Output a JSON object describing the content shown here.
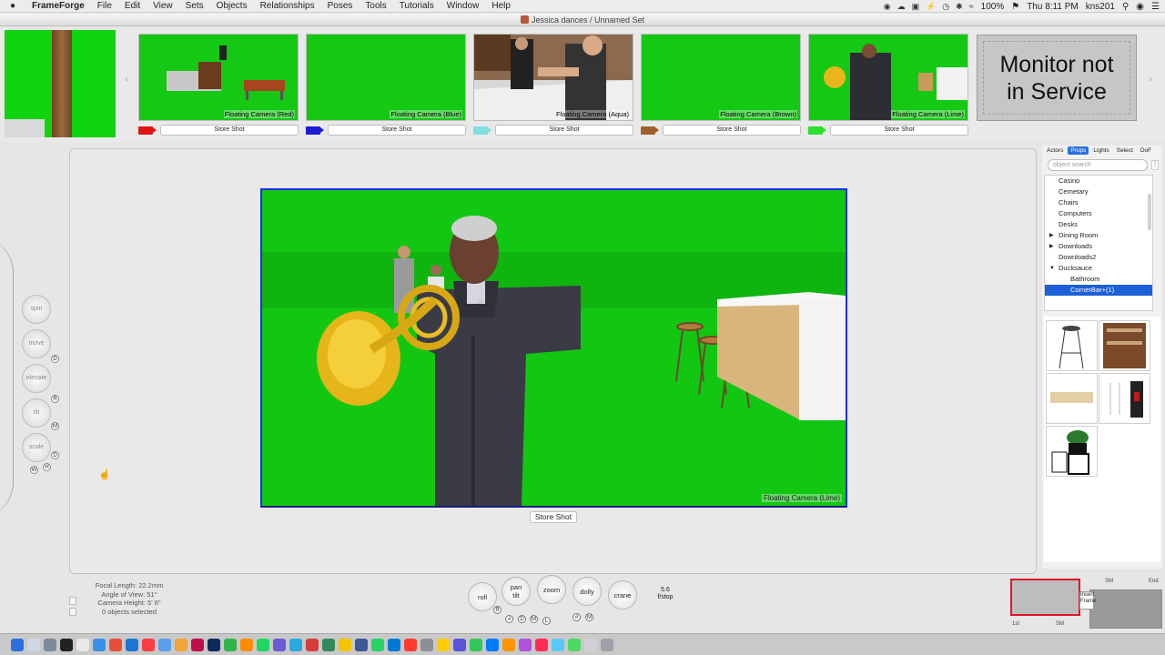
{
  "menubar": {
    "apple": "",
    "items": [
      "FrameForge",
      "File",
      "Edit",
      "View",
      "Sets",
      "Objects",
      "Relationships",
      "Poses",
      "Tools",
      "Tutorials",
      "Window",
      "Help"
    ],
    "battery": "100%",
    "clock": "Thu 8:11 PM",
    "user": "kns201"
  },
  "window": {
    "title": "Jessica dances / Unnamed Set"
  },
  "cameras": [
    {
      "caption": "Floating Camera (Red)",
      "color": "#e01616",
      "store": "Store Shot"
    },
    {
      "caption": "Floating Camera (Blue)",
      "color": "#1c1cd4",
      "store": "Store Shot"
    },
    {
      "caption": "Floating Camera (Aqua)",
      "color": "#7fdede",
      "store": "Store Shot"
    },
    {
      "caption": "Floating Camera (Brown)",
      "color": "#a0602c",
      "store": "Store Shot"
    },
    {
      "caption": "Floating Camera (Lime)",
      "color": "#2ee02e",
      "store": "Store Shot"
    }
  ],
  "monitor": {
    "line1": "Monitor not",
    "line2": "in Service"
  },
  "viewport": {
    "caption": "Floating Camera (Lime)",
    "store": "Store Shot"
  },
  "navwheel": {
    "spin": "spin",
    "move": "move",
    "elevate": "elevate",
    "tilt": "tilt",
    "scale": "scale",
    "d": "D",
    "r": "R",
    "m": "M",
    "w": "W",
    "h": "H"
  },
  "panel": {
    "tabs": [
      "Actors",
      "Props",
      "Lights",
      "Select",
      "DoF"
    ],
    "active_tab": "Props",
    "search_placeholder": "object search",
    "tree": [
      "Casino",
      "Cemetary",
      "Chairs",
      "Computers",
      "Desks",
      "Dining Room",
      "Downloads",
      "Downloads2",
      "Ducksauce",
      "Bathroom",
      "CornerBar+(1)"
    ],
    "selected": "CornerBar+(1)"
  },
  "status": {
    "focal": "Focal Length: 22.2mm",
    "angle": "Angle of View: 51°",
    "height": "Camera Height: 5' 6\"",
    "selected": "0 objects selected"
  },
  "camcontrols": {
    "roll": "roll",
    "pan": "pan",
    "tilt": "tilt",
    "zoom": "zoom",
    "dolly": "dolly",
    "crane": "crane",
    "fstop_value": "5.6",
    "fstop_label": "f/stop",
    "r": "R",
    "d": "D",
    "m": "M",
    "l": "L",
    "hash": "#"
  },
  "mini": {
    "first": "1st",
    "sm": "SM",
    "end": "End",
    "insert": "Insert Frame"
  }
}
